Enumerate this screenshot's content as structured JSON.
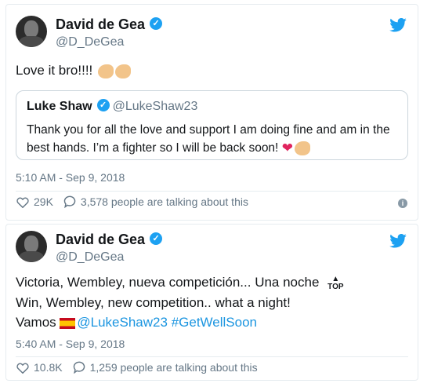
{
  "tweet1": {
    "author_name": "David de Gea",
    "author_handle": "@D_DeGea",
    "text": "Love it bro!!!!",
    "quoted": {
      "author_name": "Luke Shaw",
      "author_handle": "@LukeShaw23",
      "text": "Thank you for all the love and support I am doing fine and am in the best hands. I’m a fighter so I will be back soon!"
    },
    "timestamp": "5:10 AM - Sep 9, 2018",
    "likes": "29K",
    "talking": "3,578 people are talking about this"
  },
  "tweet2": {
    "author_name": "David de Gea",
    "author_handle": "@D_DeGea",
    "line1": "Victoria, Wembley, nueva competición... Una noche",
    "line2": "Win, Wembley, new competition.. what a night!",
    "line3_prefix": "Vamos",
    "mention": "@LukeShaw23",
    "hashtag": "#GetWellSoon",
    "top_label": "TOP",
    "timestamp": "5:40 AM - Sep 9, 2018",
    "likes": "10.8K",
    "talking": "1,259 people are talking about this"
  },
  "colors": {
    "twitter_blue": "#1da1f2",
    "link": "#1b95e0",
    "muted": "#657786",
    "heart": "#e0245e"
  },
  "icons": [
    "avatar",
    "verified-badge-icon",
    "twitter-bird-icon",
    "flexed-biceps-emoji",
    "red-heart-emoji",
    "heart-like-icon",
    "reply-bubble-icon",
    "info-icon",
    "spain-flag-emoji",
    "top-arrow-emoji"
  ]
}
